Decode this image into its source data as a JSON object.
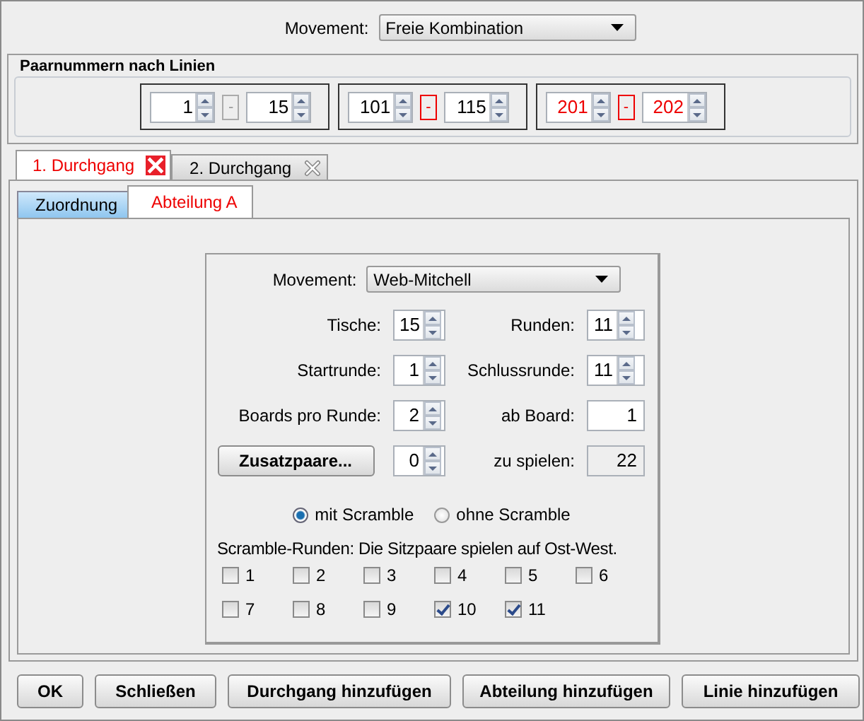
{
  "movement": {
    "label": "Movement:",
    "value": "Freie Kombination"
  },
  "pair_numbers": {
    "title": "Paarnummern nach Linien",
    "lines": [
      {
        "from": "1",
        "separator": "-",
        "to": "15",
        "separator_error": false,
        "numbers_error": false
      },
      {
        "from": "101",
        "separator": "-",
        "to": "115",
        "separator_error": true,
        "numbers_error": false
      },
      {
        "from": "201",
        "separator": "-",
        "to": "202",
        "separator_error": true,
        "numbers_error": true
      }
    ]
  },
  "round_tabs": [
    {
      "label": "1. Durchgang",
      "selected": true
    },
    {
      "label": "2. Durchgang",
      "selected": false
    }
  ],
  "section_tabs": [
    {
      "label": "Zuordnung",
      "selected": false
    },
    {
      "label": "Abteilung A",
      "selected": true
    }
  ],
  "section": {
    "movement": {
      "label": "Movement:",
      "value": "Web-Mitchell"
    },
    "fields": [
      {
        "label": "Tische:",
        "value": "15",
        "kind": "spinner"
      },
      {
        "label": "Runden:",
        "value": "11",
        "kind": "spinner"
      },
      {
        "label": "Startrunde:",
        "value": "1",
        "kind": "spinner"
      },
      {
        "label": "Schlussrunde:",
        "value": "11",
        "kind": "spinner"
      },
      {
        "label": "Boards pro Runde:",
        "value": "2",
        "kind": "spinner"
      },
      {
        "label": "ab Board:",
        "value": "1",
        "kind": "text"
      },
      {
        "label": "Zusatzpaare...",
        "value": "0",
        "kind": "button-spinner"
      },
      {
        "label": "zu spielen:",
        "value": "22",
        "kind": "readonly"
      }
    ],
    "scramble_options": [
      {
        "label": "mit Scramble",
        "selected": true
      },
      {
        "label": "ohne Scramble",
        "selected": false
      }
    ],
    "scramble_caption": "Scramble-Runden: Die Sitzpaare spielen auf Ost-West.",
    "scramble_rounds": [
      {
        "label": "1",
        "checked": false
      },
      {
        "label": "2",
        "checked": false
      },
      {
        "label": "3",
        "checked": false
      },
      {
        "label": "4",
        "checked": false
      },
      {
        "label": "5",
        "checked": false
      },
      {
        "label": "6",
        "checked": false
      },
      {
        "label": "7",
        "checked": false
      },
      {
        "label": "8",
        "checked": false
      },
      {
        "label": "9",
        "checked": false
      },
      {
        "label": "10",
        "checked": true
      },
      {
        "label": "11",
        "checked": true
      }
    ]
  },
  "buttons": [
    "OK",
    "Schließen",
    "Durchgang hinzufügen",
    "Abteilung hinzufügen",
    "Linie hinzufügen"
  ]
}
